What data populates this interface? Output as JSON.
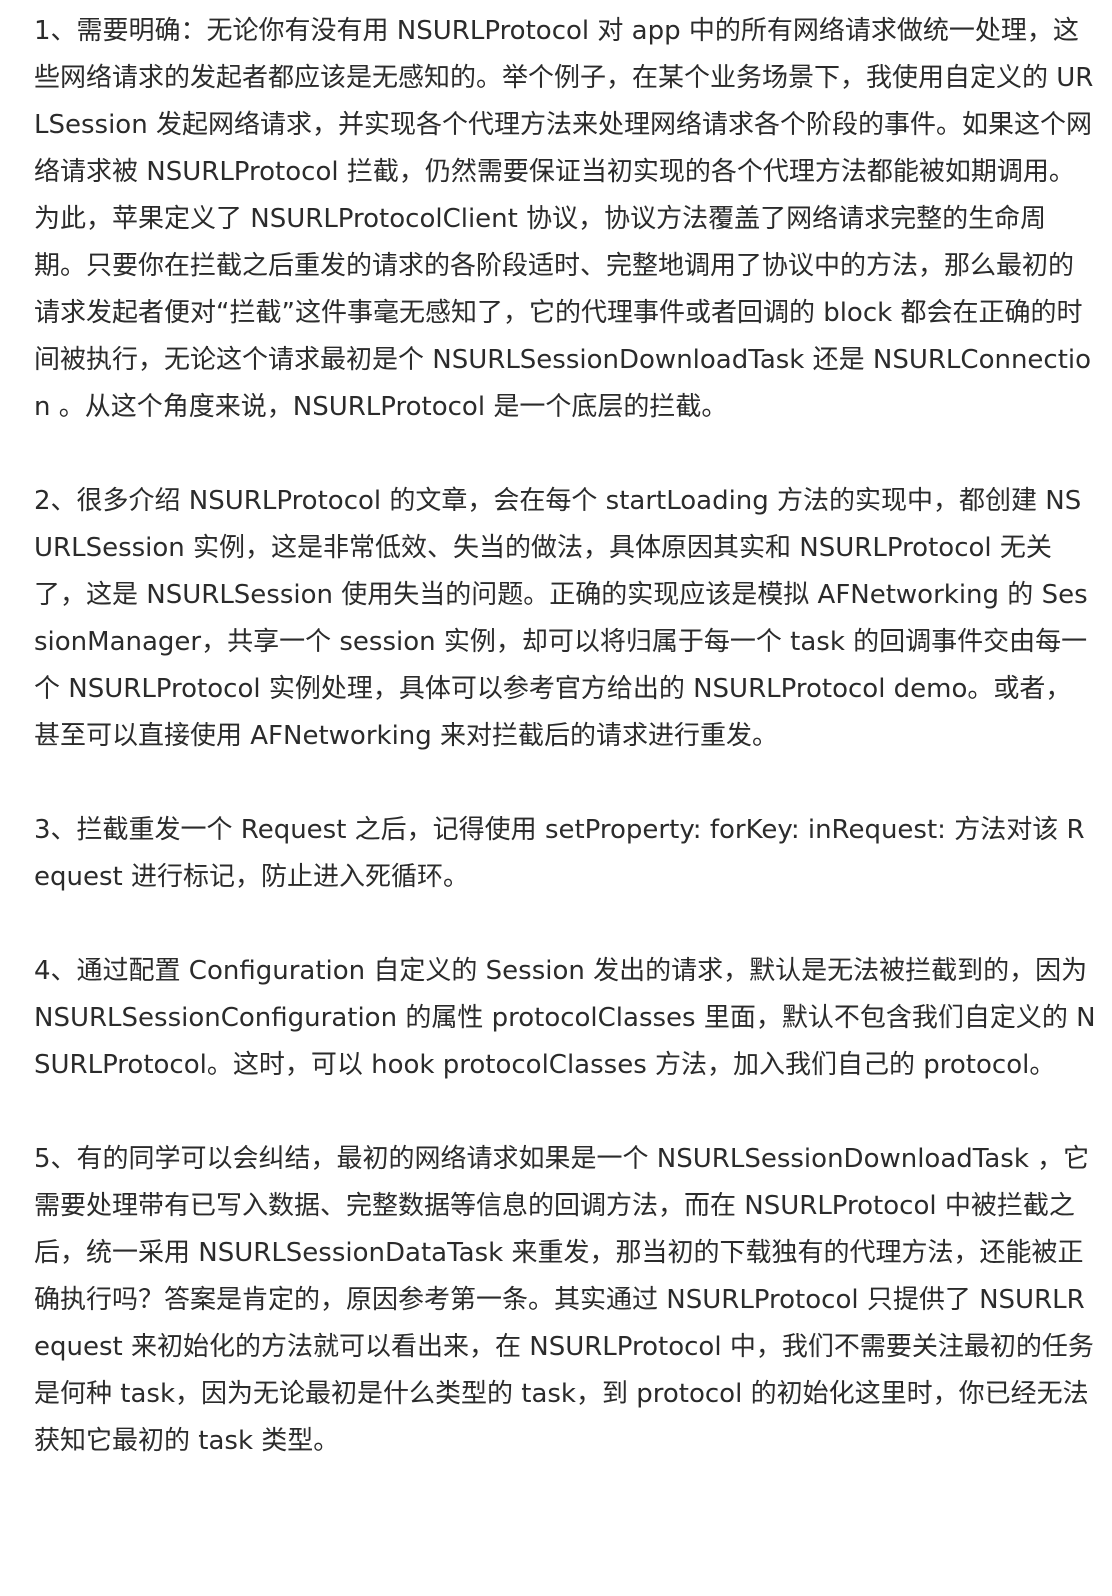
{
  "paragraphs": [
    "1、需要明确：无论你有没有用 NSURLProtocol 对 app 中的所有网络请求做统一处理，这些网络请求的发起者都应该是无感知的。举个例子，在某个业务场景下，我使用自定义的 URLSession 发起网络请求，并实现各个代理方法来处理网络请求各个阶段的事件。如果这个网络请求被 NSURLProtocol 拦截，仍然需要保证当初实现的各个代理方法都能被如期调用。为此，苹果定义了 NSURLProtocolClient 协议，协议方法覆盖了网络请求完整的生命周期。只要你在拦截之后重发的请求的各阶段适时、完整地调用了协议中的方法，那么最初的请求发起者便对“拦截”这件事毫无感知了，它的代理事件或者回调的 block 都会在正确的时间被执行，无论这个请求最初是个 NSURLSessionDownloadTask 还是 NSURLConnection 。从这个角度来说，NSURLProtocol 是一个底层的拦截。",
    "2、很多介绍 NSURLProtocol 的文章，会在每个 startLoading 方法的实现中，都创建 NSURLSession 实例，这是非常低效、失当的做法，具体原因其实和 NSURLProtocol 无关了，这是 NSURLSession 使用失当的问题。正确的实现应该是模拟 AFNetworking 的 SessionManager，共享一个 session 实例，却可以将归属于每一个 task 的回调事件交由每一个 NSURLProtocol 实例处理，具体可以参考官方给出的 NSURLProtocol demo。或者，甚至可以直接使用 AFNetworking 来对拦截后的请求进行重发。",
    "3、拦截重发一个 Request 之后，记得使用 setProperty: forKey: inRequest: 方法对该 Request 进行标记，防止进入死循环。",
    "4、通过配置 Configuration 自定义的 Session 发出的请求，默认是无法被拦截到的，因为 NSURLSessionConfiguration 的属性 protocolClasses 里面，默认不包含我们自定义的 NSURLProtocol。这时，可以 hook protocolClasses 方法，加入我们自己的 protocol。",
    "5、有的同学可以会纠结，最初的网络请求如果是一个 NSURLSessionDownloadTask ，它需要处理带有已写入数据、完整数据等信息的回调方法，而在 NSURLProtocol 中被拦截之后，统一采用 NSURLSessionDataTask 来重发，那当初的下载独有的代理方法，还能被正确执行吗？答案是肯定的，原因参考第一条。其实通过 NSURLProtocol 只提供了 NSURLRequest 来初始化的方法就可以看出来，在 NSURLProtocol 中，我们不需要关注最初的任务是何种 task，因为无论最初是什么类型的 task，到 protocol 的初始化这里时，你已经无法获知它最初的 task 类型。"
  ]
}
